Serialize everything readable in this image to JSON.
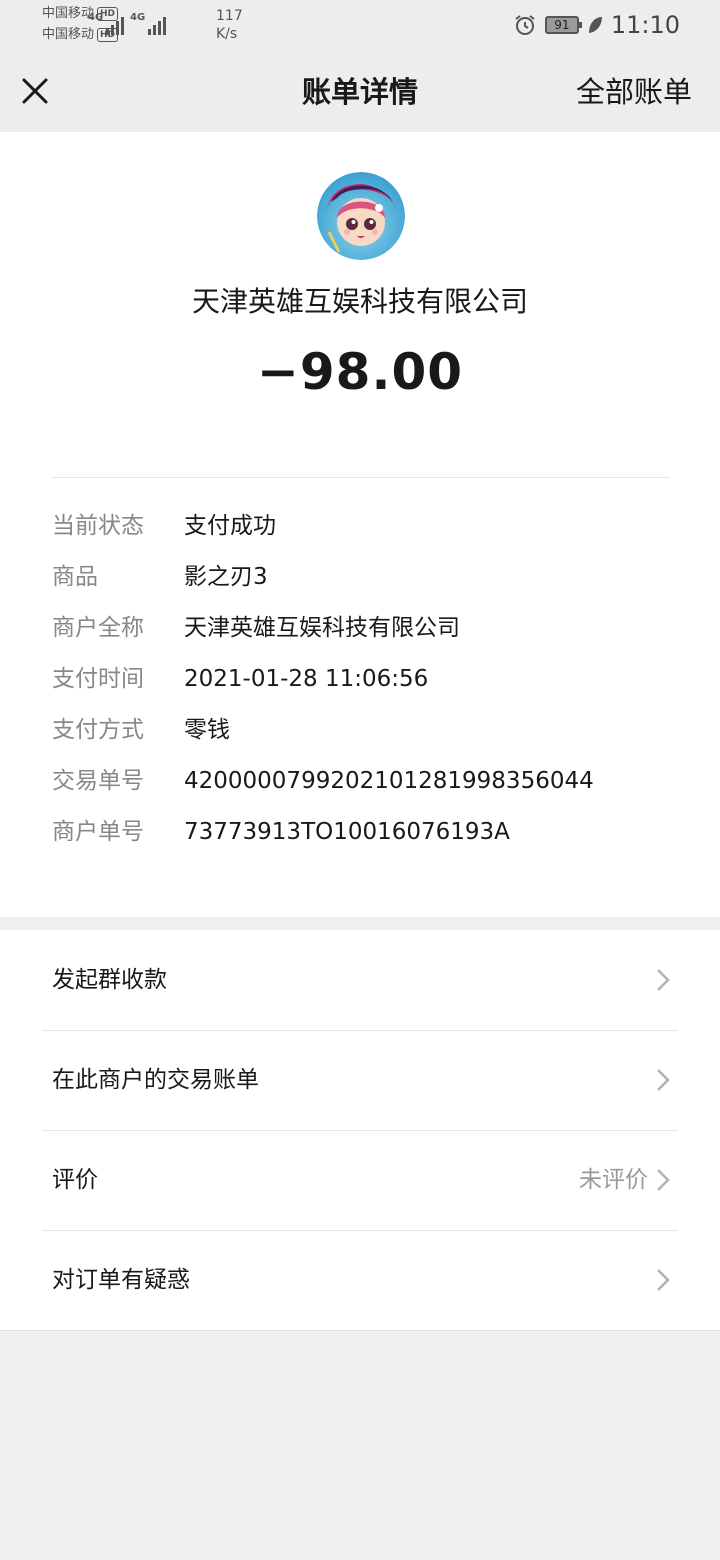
{
  "status_bar": {
    "carrier1": "中国移动",
    "carrier2": "中国移动",
    "hd": "HD",
    "net1": "4G",
    "net2": "4G",
    "speed_value": "117",
    "speed_unit": "K/s",
    "battery": "91",
    "time": "11:10",
    "icons": [
      "alarm-icon",
      "battery-icon",
      "leaf-icon",
      "signal-icon"
    ]
  },
  "nav": {
    "title": "账单详情",
    "right_link": "全部账单",
    "close_icon": "close-icon"
  },
  "merchant": {
    "name": "天津英雄互娱科技有限公司",
    "amount": "−98.00"
  },
  "details": [
    {
      "label": "当前状态",
      "value": "支付成功"
    },
    {
      "label": "商品",
      "value": "影之刃3"
    },
    {
      "label": "商户全称",
      "value": "天津英雄互娱科技有限公司"
    },
    {
      "label": "支付时间",
      "value": "2021-01-28 11:06:56"
    },
    {
      "label": "支付方式",
      "value": "零钱"
    },
    {
      "label": "交易单号",
      "value": "4200000799202101281998356044"
    },
    {
      "label": "商户单号",
      "value": "73773913TO10016076193A"
    }
  ],
  "actions": [
    {
      "label": "发起群收款",
      "sub": ""
    },
    {
      "label": "在此商户的交易账单",
      "sub": ""
    },
    {
      "label": "评价",
      "sub": "未评价"
    },
    {
      "label": "对订单有疑惑",
      "sub": ""
    }
  ],
  "colors": {
    "background": "#f0f0f0",
    "card": "#ffffff",
    "text": "#191919",
    "label": "#888888"
  }
}
